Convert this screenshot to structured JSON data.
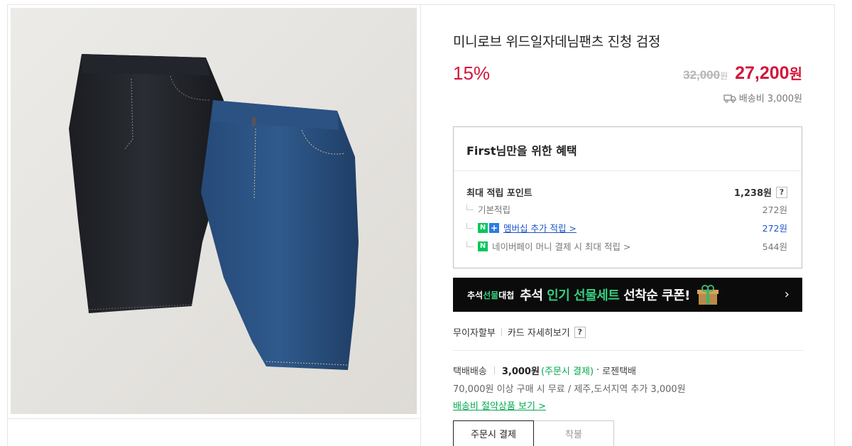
{
  "product": {
    "title": "미니로브 위드일자데님팬츠 진청 검정",
    "discount": "15%",
    "original_price": "32,000",
    "original_unit": "원",
    "sale_price": "27,200",
    "sale_unit": "원",
    "shipping_fee_label": "배송비 3,000원"
  },
  "benefit": {
    "title": "First님만을 위한 혜택",
    "max_points_label": "최대 적립 포인트",
    "max_points_value": "1,238원",
    "help": "?",
    "rows": [
      {
        "label": "기본적립",
        "value": "272원"
      },
      {
        "label": "멤버십 추가 적립 >",
        "value": "272원",
        "badge1": "N",
        "badge2": "+"
      },
      {
        "label": "네이버페이 머니 결제 시 최대 적립 >",
        "value": "544원",
        "badge1": "N"
      }
    ]
  },
  "banner": {
    "tag_a": "추석",
    "tag_b": "선물",
    "tag_c": "대첩",
    "text_a": "추석 ",
    "text_b": "인기 선물세트",
    "text_c": " 선착순 쿠폰!",
    "arrow": "›"
  },
  "payment": {
    "installment": "무이자할부",
    "card_detail": "카드 자세히보기",
    "help": "?"
  },
  "delivery": {
    "method": "택배배송",
    "fee": "3,000원",
    "pay_when": "(주문시 결제)",
    "dot": "·",
    "carrier": "로젠택배",
    "condition": "70,000원 이상 구매 시 무료 / 제주,도서지역 추가 3,000원",
    "save_link": "배송비 절약상품 보기 >"
  },
  "tabs": [
    {
      "label": "주문시 결제",
      "active": true
    },
    {
      "label": "착불",
      "active": false
    }
  ],
  "colors": {
    "accent_red": "#d3163a",
    "naver_green": "#03c75a",
    "link_blue": "#1e55c7",
    "banner_bg": "#0b0b0b"
  }
}
